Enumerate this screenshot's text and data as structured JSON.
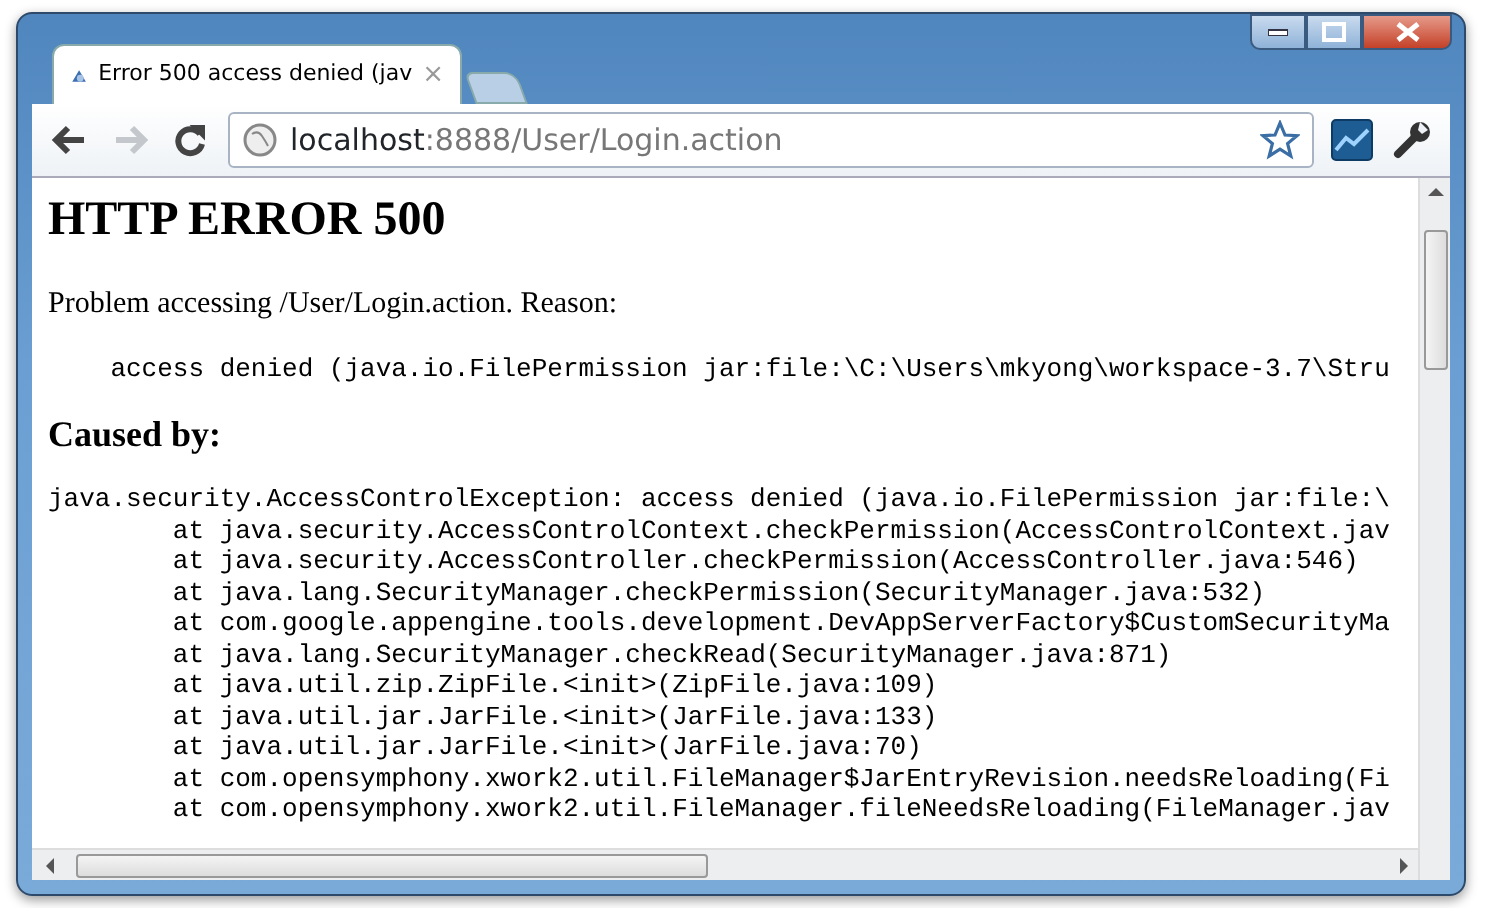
{
  "tabs": [
    {
      "title": "Error 500 access denied (jav",
      "selected": true,
      "close": "×"
    }
  ],
  "nav_buttons": [
    {
      "kind": "back",
      "disabled": false
    },
    {
      "kind": "forward",
      "disabled": true
    },
    {
      "kind": "reload",
      "disabled": false
    }
  ],
  "address_bar": {
    "host": "localhost",
    "rest": ":8888/User/Login.action"
  },
  "page": {
    "heading": "HTTP ERROR 500",
    "problem": "Problem accessing /User/Login.action. Reason:",
    "reason": "    access denied (java.io.FilePermission jar:file:\\C:\\Users\\mkyong\\workspace-3.7\\Stru",
    "caused_by": "Caused by:",
    "stack": [
      "java.security.AccessControlException: access denied (java.io.FilePermission jar:file:\\",
      "\tat java.security.AccessControlContext.checkPermission(AccessControlContext.jav",
      "\tat java.security.AccessController.checkPermission(AccessController.java:546)",
      "\tat java.lang.SecurityManager.checkPermission(SecurityManager.java:532)",
      "\tat com.google.appengine.tools.development.DevAppServerFactory$CustomSecurityMa",
      "\tat java.lang.SecurityManager.checkRead(SecurityManager.java:871)",
      "\tat java.util.zip.ZipFile.<init>(ZipFile.java:109)",
      "\tat java.util.jar.JarFile.<init>(JarFile.java:133)",
      "\tat java.util.jar.JarFile.<init>(JarFile.java:70)",
      "\tat com.opensymphony.xwork2.util.FileManager$JarEntryRevision.needsReloading(Fi",
      "\tat com.opensymphony.xwork2.util.FileManager.fileNeedsReloading(FileManager.jav"
    ]
  }
}
